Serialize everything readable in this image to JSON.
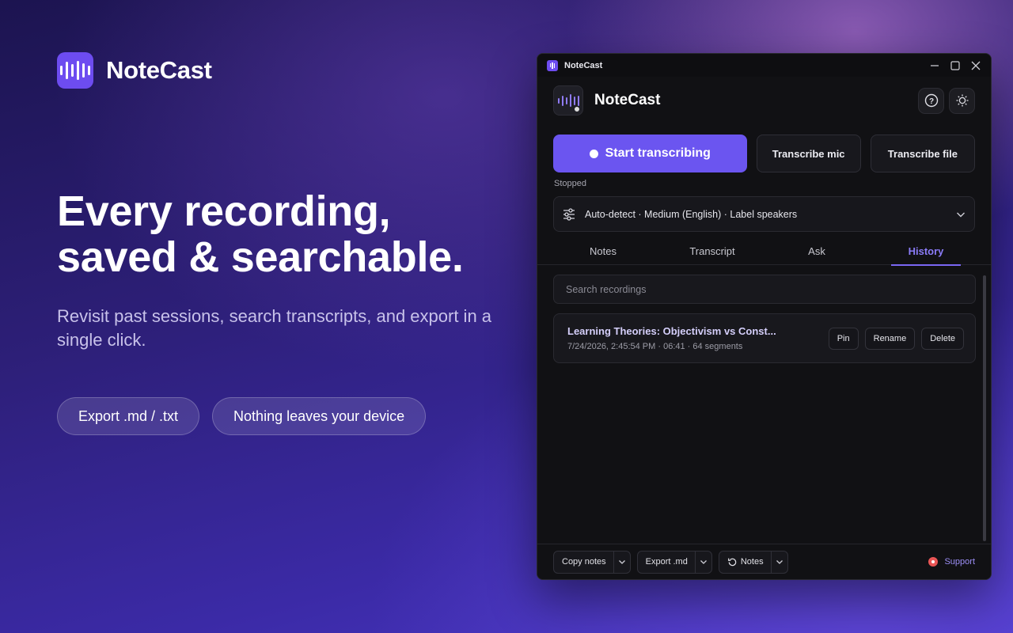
{
  "brand": {
    "name": "NoteCast"
  },
  "hero": {
    "line1": "Every recording,",
    "line2": "saved & searchable.",
    "subtitle": "Revisit past sessions, search transcripts, and export in a single click."
  },
  "pills": [
    "Export .md / .txt",
    "Nothing leaves your device"
  ],
  "window": {
    "title": "NoteCast",
    "app_name": "NoteCast",
    "actions": {
      "start": "Start transcribing",
      "mic": "Transcribe mic",
      "file": "Transcribe file"
    },
    "status": "Stopped",
    "settings_summary": "Auto-detect · Medium (English) · Label speakers",
    "tabs": [
      "Notes",
      "Transcript",
      "Ask",
      "History"
    ],
    "active_tab": "History",
    "search": {
      "placeholder": "Search recordings",
      "value": ""
    },
    "recordings": [
      {
        "title": "Learning Theories: Objectivism vs Const...",
        "meta": "7/24/2026, 2:45:54 PM · 06:41 · 64 segments",
        "buttons": [
          "Pin",
          "Rename",
          "Delete"
        ]
      }
    ],
    "footer": {
      "copy_notes": "Copy notes",
      "export_md": "Export .md",
      "notes": "Notes",
      "support": "Support"
    }
  },
  "colors": {
    "accent": "#6b55f0",
    "accent_text": "#8b7cf8",
    "window_bg": "#111114",
    "support_dot": "#e95555"
  }
}
